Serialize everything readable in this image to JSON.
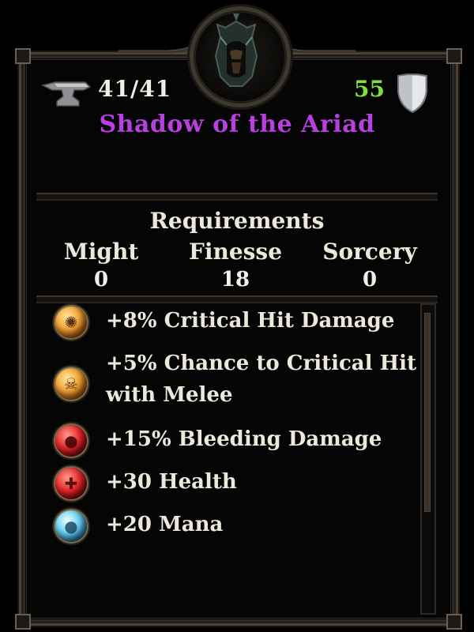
{
  "item": {
    "durability": "41/41",
    "armor": "55",
    "name": "Shadow of the Ariad",
    "name_color": "#b83fe0"
  },
  "icons": {
    "portrait": "hooded-helm-icon",
    "durability": "anvil-icon",
    "armor": "shield-icon"
  },
  "requirements": {
    "title": "Requirements",
    "attributes": [
      {
        "name": "Might",
        "value": "0"
      },
      {
        "name": "Finesse",
        "value": "18"
      },
      {
        "name": "Sorcery",
        "value": "0"
      }
    ]
  },
  "stats": [
    {
      "text": "+8% Critical Hit Damage",
      "icon": "sunburst-orb-icon",
      "color": "gold"
    },
    {
      "text": "+5% Chance to Critical Hit with Melee",
      "icon": "skull-orb-icon",
      "color": "gold"
    },
    {
      "text": "+15% Bleeding Damage",
      "icon": "blood-drop-orb-icon",
      "color": "red"
    },
    {
      "text": "+30 Health",
      "icon": "health-orb-icon",
      "color": "red"
    },
    {
      "text": "+20 Mana",
      "icon": "mana-drop-orb-icon",
      "color": "blue"
    }
  ],
  "colors": {
    "armor_value": "#7ee03a",
    "frame": "#4a423a"
  }
}
